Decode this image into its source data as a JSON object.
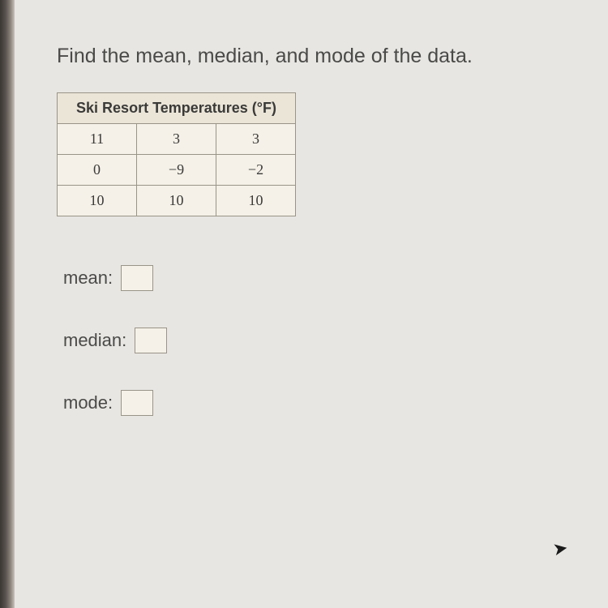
{
  "prompt": "Find the mean, median, and mode of the data.",
  "table": {
    "header": "Ski Resort Temperatures (°F)",
    "rows": [
      [
        "11",
        "3",
        "3"
      ],
      [
        "0",
        "−9",
        "−2"
      ],
      [
        "10",
        "10",
        "10"
      ]
    ]
  },
  "answers": {
    "mean_label": "mean:",
    "median_label": "median:",
    "mode_label": "mode:"
  },
  "chart_data": {
    "type": "table",
    "title": "Ski Resort Temperatures (°F)",
    "values": [
      11,
      3,
      3,
      0,
      -9,
      -2,
      10,
      10,
      10
    ]
  }
}
